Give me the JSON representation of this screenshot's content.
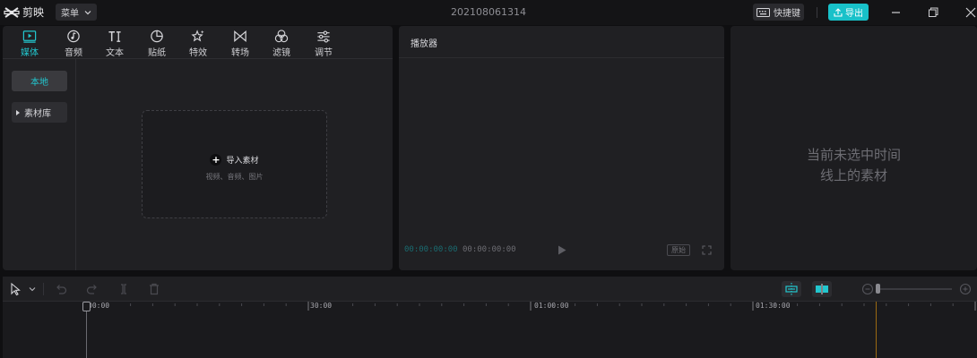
{
  "app": {
    "name": "剪映",
    "menu_label": "菜单",
    "project_title": "202108061314",
    "shortcut_label": "快捷键",
    "export_label": "导出",
    "accent_color": "#18c1c9"
  },
  "media": {
    "tabs": [
      {
        "label": "媒体",
        "icon": "media-icon",
        "active": true
      },
      {
        "label": "音频",
        "icon": "audio-icon",
        "active": false
      },
      {
        "label": "文本",
        "icon": "text-icon",
        "active": false
      },
      {
        "label": "贴纸",
        "icon": "sticker-icon",
        "active": false
      },
      {
        "label": "特效",
        "icon": "effects-icon",
        "active": false
      },
      {
        "label": "转场",
        "icon": "transition-icon",
        "active": false
      },
      {
        "label": "滤镜",
        "icon": "filter-icon",
        "active": false
      },
      {
        "label": "调节",
        "icon": "adjust-icon",
        "active": false
      }
    ],
    "sidebar": {
      "local_label": "本地",
      "library_label": "素材库"
    },
    "import": {
      "label": "导入素材",
      "hint": "视频、音频、图片"
    }
  },
  "player": {
    "title": "播放器",
    "time_current": "00:00:00:00",
    "time_total": "00:00:00:00",
    "ratio_label": "原始"
  },
  "properties": {
    "empty_line1": "当前未选中时间",
    "empty_line2": "线上的素材"
  },
  "timeline": {
    "ruler_labels": [
      "00:00",
      "30:00",
      "01:00:00",
      "01:30:00"
    ]
  }
}
